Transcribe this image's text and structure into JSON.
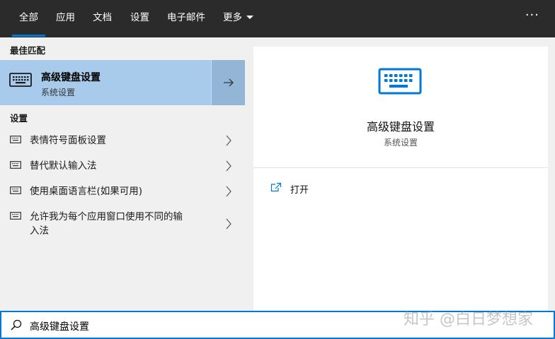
{
  "colors": {
    "accent": "#0078d7",
    "topbar": "#2b2b2b",
    "selected": "#a8cbeb"
  },
  "tabs": [
    {
      "label": "全部",
      "active": true
    },
    {
      "label": "应用"
    },
    {
      "label": "文档"
    },
    {
      "label": "设置"
    },
    {
      "label": "电子邮件"
    },
    {
      "label": "更多",
      "dropdown": true
    }
  ],
  "more_options": "···",
  "left": {
    "best_match_header": "最佳匹配",
    "best_match": {
      "title": "高级键盘设置",
      "subtitle": "系统设置",
      "icon": "keyboard-icon",
      "action_icon": "arrow-right-icon"
    },
    "settings_header": "设置",
    "items": [
      {
        "label": "表情符号面板设置",
        "icon": "keyboard-icon"
      },
      {
        "label": "替代默认输入法",
        "icon": "keyboard-icon"
      },
      {
        "label": "使用桌面语言栏(如果可用)",
        "icon": "keyboard-icon"
      },
      {
        "label_line1": "允许我为每个应用窗口使用不同的输",
        "label_line2": "入法",
        "icon": "keyboard-icon"
      }
    ]
  },
  "preview": {
    "title": "高级键盘设置",
    "subtitle": "系统设置",
    "icon": "keyboard-icon",
    "actions": [
      {
        "label": "打开",
        "icon": "open-icon"
      }
    ]
  },
  "search": {
    "value": "高级键盘设置",
    "icon": "search-icon"
  },
  "watermark": "知乎 @白日梦想家"
}
